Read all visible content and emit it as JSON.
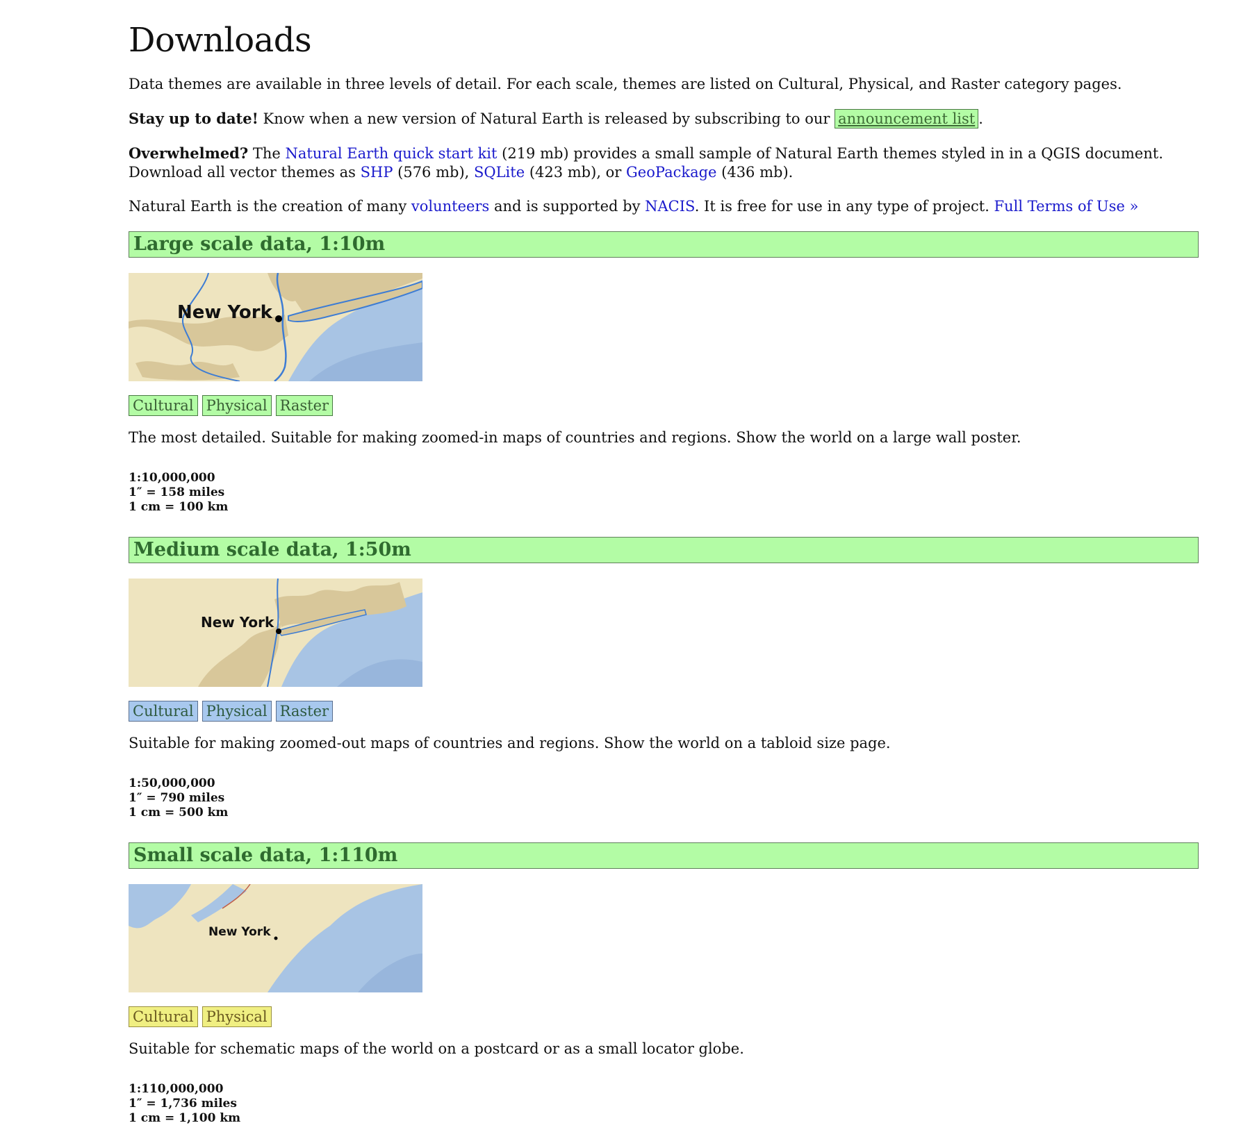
{
  "title": "Downloads",
  "intro": "Data themes are available in three levels of detail. For each scale, themes are listed on Cultural, Physical, and Raster category pages.",
  "stay": {
    "bold": "Stay up to date!",
    "text": " Know when a new version of Natural Earth is released by subscribing to our ",
    "link": "announcement list",
    "end": "."
  },
  "overwhelmed": {
    "bold": "Overwhelmed?",
    "t1": " The ",
    "kit_link": "Natural Earth quick start kit",
    "t2": " (219 mb) provides a small sample of Natural Earth themes styled in in a QGIS document. Download all vector themes as ",
    "shp_link": "SHP",
    "t3": " (576 mb), ",
    "sqlite_link": "SQLite",
    "t4": " (423 mb), or ",
    "gpkg_link": "GeoPackage",
    "t5": " (436 mb)."
  },
  "credits": {
    "t1": "Natural Earth is the creation of many ",
    "volunteers_link": "volunteers",
    "t2": " and is supported by ",
    "nacis_link": "NACIS",
    "t3": ". It is free for use in any type of project. ",
    "terms_link": "Full Terms of Use »"
  },
  "sections": [
    {
      "heading": "Large scale data, 1:10m",
      "map_label": "New York",
      "buttons": [
        "Cultural",
        "Physical",
        "Raster"
      ],
      "description": "The most detailed. Suitable for making zoomed-in maps of countries and regions. Show the world on a large wall poster.",
      "scale": [
        "1:10,000,000",
        "1″ = 158 miles",
        "1 cm = 100 km"
      ]
    },
    {
      "heading": "Medium scale data, 1:50m",
      "map_label": "New York",
      "buttons": [
        "Cultural",
        "Physical",
        "Raster"
      ],
      "description": "Suitable for making zoomed-out maps of countries and regions. Show the world on a tabloid size page.",
      "scale": [
        "1:50,000,000",
        "1″ = 790 miles",
        "1 cm = 500 km"
      ]
    },
    {
      "heading": "Small scale data, 1:110m",
      "map_label": "New York",
      "buttons": [
        "Cultural",
        "Physical"
      ],
      "description": "Suitable for schematic maps of the world on a postcard or as a small locator globe.",
      "scale": [
        "1:110,000,000",
        "1″ = 1,736 miles",
        "1 cm = 1,100 km"
      ]
    }
  ],
  "colors": {
    "green_button": "#b3fca5",
    "blue_button": "#a8c8ee",
    "yellow_button": "#f0ef82",
    "link": "#1a1acc",
    "land": "#eee4bf",
    "urban": "#d8c79a",
    "water": "#a8c4e4"
  }
}
